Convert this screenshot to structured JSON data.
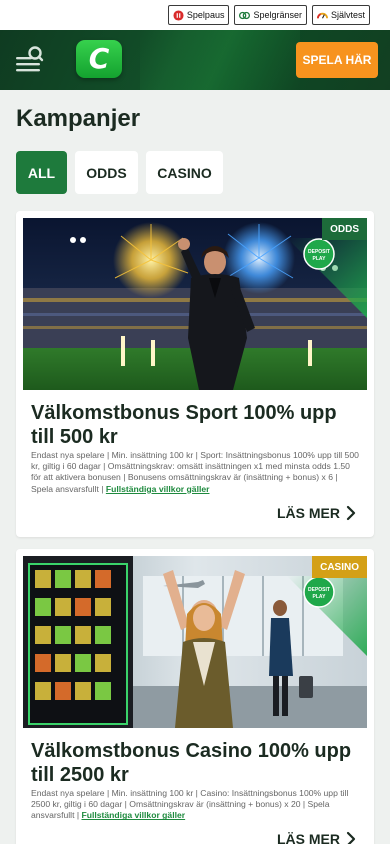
{
  "responsible_gaming": {
    "pause_label": "Spelpaus",
    "limits_label": "Spelgränser",
    "test_label": "Självtest"
  },
  "header": {
    "logo_text": "C",
    "cta_label": "SPELA HÄR"
  },
  "page_title": "Kampanjer",
  "filters": [
    {
      "label": "ALL",
      "active": true
    },
    {
      "label": "ODDS",
      "active": false
    },
    {
      "label": "CASINO",
      "active": false
    }
  ],
  "promotions": [
    {
      "badge": "ODDS",
      "title": "Välkomstbonus Sport 100% upp till 500 kr",
      "terms": "Endast nya spelare | Min. insättning 100 kr | Sport: Insättningsbonus 100% upp till 500 kr, giltig i 60 dagar | Omsättningskrav: omsätt insättningen x1 med minsta odds 1.50 för att aktivera bonusen | Bonusens omsättningskrav är (insättning + bonus) x 6 | Spela ansvarsfullt |",
      "terms_link": "Fullständiga villkor gäller",
      "read_more": "LÄS MER",
      "stamp_text": "DEPOSIT PLAY"
    },
    {
      "badge": "CASINO",
      "title": "Välkomstbonus Casino 100% upp till 2500 kr",
      "terms": "Endast nya spelare | Min. insättning 100 kr | Casino: Insättningsbonus 100% upp till 2500 kr, giltig i 60 dagar | Omsättningskrav är (insättning + bonus) x 20 | Spela ansvarsfullt |",
      "terms_link": "Fullständiga villkor gäller",
      "read_more": "LÄS MER",
      "stamp_text": "DEPOSIT PLAY"
    }
  ],
  "colors": {
    "brand_green": "#1e7a3c",
    "header_dark": "#0f3b21",
    "cta_orange": "#f7931e",
    "badge_odds": "#1d6b3a",
    "badge_casino": "#d4a017",
    "link_green": "#1e8a3e"
  }
}
